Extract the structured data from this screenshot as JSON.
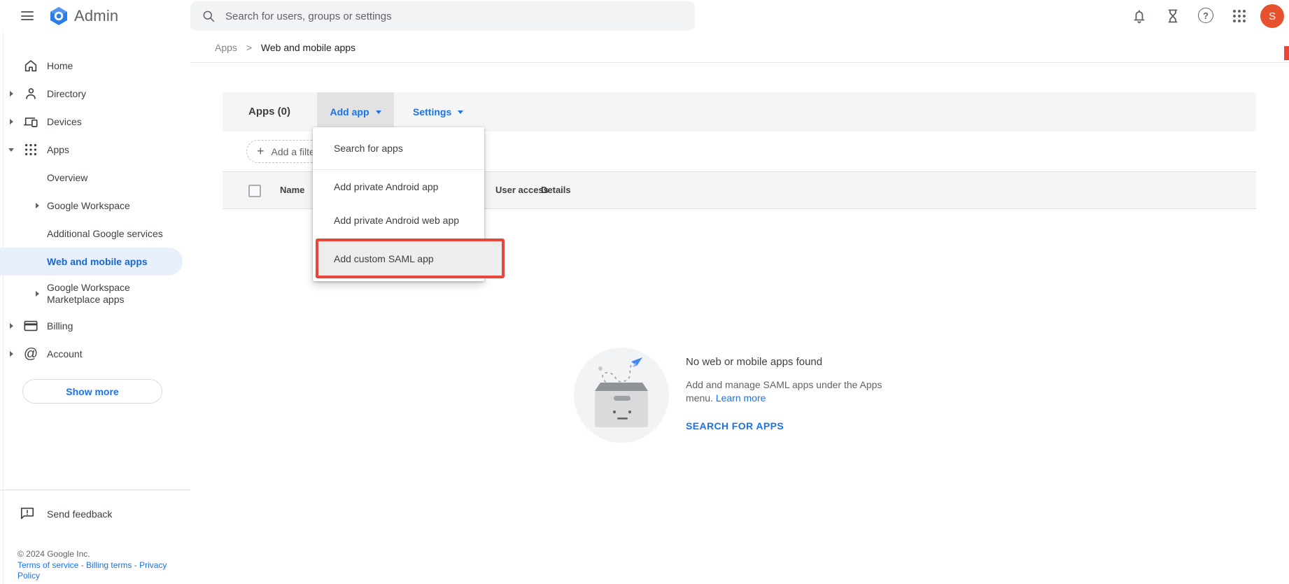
{
  "header": {
    "brand": "Admin",
    "search_placeholder": "Search for users, groups or settings",
    "avatar": "S"
  },
  "breadcrumb": {
    "parent": "Apps",
    "separator": ">",
    "current": "Web and mobile apps"
  },
  "sidebar": {
    "home": "Home",
    "directory": "Directory",
    "devices": "Devices",
    "apps": "Apps",
    "overview": "Overview",
    "google_workspace": "Google Workspace",
    "additional_services": "Additional Google services",
    "web_mobile": "Web and mobile apps",
    "marketplace": "Google Workspace Marketplace apps",
    "billing": "Billing",
    "account": "Account",
    "show_more": "Show more",
    "send_feedback": "Send feedback",
    "copyright": "© 2024 Google Inc.",
    "terms": "Terms of service",
    "billing_terms": "Billing terms",
    "privacy": "Privacy Policy",
    "link_separator": "-"
  },
  "toolbar": {
    "title": "Apps (0)",
    "add_app": "Add app",
    "settings": "Settings"
  },
  "filter": {
    "label": "Add a filter"
  },
  "table": {
    "name": "Name",
    "user_access": "User access",
    "details": "Details"
  },
  "menu": {
    "search_for_apps": "Search for apps",
    "private_android": "Add private Android app",
    "private_android_web": "Add private Android web app",
    "custom_saml": "Add custom SAML app",
    "highlighted_item": "Add custom SAML app"
  },
  "empty": {
    "title": "No web or mobile apps found",
    "desc": "Add and manage SAML apps under the Apps menu.",
    "learn_more": "Learn more",
    "cta": "SEARCH FOR APPS"
  },
  "icons": {
    "question": "?",
    "at": "@",
    "plus": "+",
    "sort_asc": "↑"
  },
  "colors": {
    "accent_blue": "#1a73e8",
    "selected_item_bg": "#e8f0fe",
    "annotation_red": "#e8453b",
    "avatar_color": "#e8512d",
    "toolbar_gray": "#f5f5f5"
  }
}
